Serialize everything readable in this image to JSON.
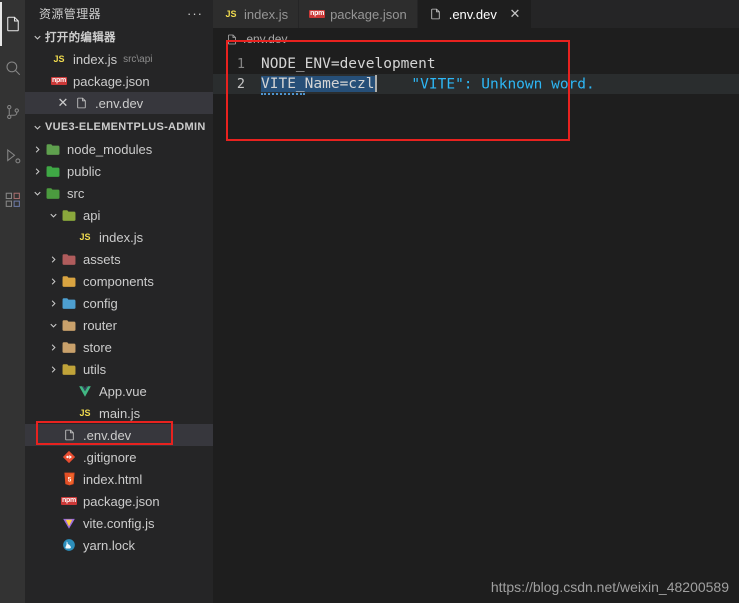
{
  "colors": {
    "activity_bar_bg": "#333333",
    "sidebar_bg": "#252526",
    "editor_bg": "#1e1e1e",
    "tab_active_bg": "#1e1e1e",
    "tab_inactive_bg": "#2d2d2d",
    "selection_bg": "#264f78",
    "annotation_red": "#e8221f",
    "hint_blue": "#2db7f5",
    "js_yellow": "#f0db4f",
    "npm_red": "#cb3837",
    "vue_green": "#41b883",
    "folder_blue": "#519aba"
  },
  "activity_bar": {
    "items": [
      {
        "name": "explorer-icon",
        "active": true
      },
      {
        "name": "search-icon",
        "active": false
      },
      {
        "name": "source-control-icon",
        "active": false
      },
      {
        "name": "run-and-debug-icon",
        "active": false
      },
      {
        "name": "extensions-icon",
        "active": false
      }
    ]
  },
  "sidebar": {
    "title": "资源管理器",
    "more_actions": "···",
    "open_editors": {
      "label": "打开的编辑器",
      "expanded": true,
      "items": [
        {
          "label": "index.js",
          "sub": "src\\api",
          "icon": "js-file-icon",
          "selected": false,
          "has_close": false
        },
        {
          "label": "package.json",
          "sub": "",
          "icon": "npm-file-icon",
          "selected": false,
          "has_close": false
        },
        {
          "label": ".env.dev",
          "sub": "",
          "icon": "plain-file-icon",
          "selected": true,
          "has_close": true
        }
      ]
    },
    "project": {
      "label": "VUE3-ELEMENTPLUS-ADMIN",
      "expanded": true,
      "tree": [
        {
          "label": "node_modules",
          "type": "folder",
          "icon": "folder-node-modules-icon",
          "depth": 1,
          "expanded": false,
          "selected": false,
          "annotated": false
        },
        {
          "label": "public",
          "type": "folder",
          "icon": "folder-public-icon",
          "depth": 1,
          "expanded": false,
          "selected": false,
          "annotated": false
        },
        {
          "label": "src",
          "type": "folder",
          "icon": "folder-src-icon",
          "depth": 1,
          "expanded": true,
          "selected": false,
          "annotated": false
        },
        {
          "label": "api",
          "type": "folder",
          "icon": "folder-api-icon",
          "depth": 2,
          "expanded": true,
          "selected": false,
          "annotated": false
        },
        {
          "label": "index.js",
          "type": "file",
          "icon": "js-file-icon",
          "depth": 3,
          "expanded": null,
          "selected": false,
          "annotated": false
        },
        {
          "label": "assets",
          "type": "folder",
          "icon": "folder-assets-icon",
          "depth": 2,
          "expanded": false,
          "selected": false,
          "annotated": false
        },
        {
          "label": "components",
          "type": "folder",
          "icon": "folder-components-icon",
          "depth": 2,
          "expanded": false,
          "selected": false,
          "annotated": false
        },
        {
          "label": "config",
          "type": "folder",
          "icon": "folder-config-icon",
          "depth": 2,
          "expanded": false,
          "selected": false,
          "annotated": false
        },
        {
          "label": "router",
          "type": "folder",
          "icon": "folder-router-icon",
          "depth": 2,
          "expanded": true,
          "selected": false,
          "annotated": false
        },
        {
          "label": "store",
          "type": "folder",
          "icon": "folder-store-icon",
          "depth": 2,
          "expanded": false,
          "selected": false,
          "annotated": false
        },
        {
          "label": "utils",
          "type": "folder",
          "icon": "folder-utils-icon",
          "depth": 2,
          "expanded": false,
          "selected": false,
          "annotated": false
        },
        {
          "label": "App.vue",
          "type": "file",
          "icon": "vue-file-icon",
          "depth": 3,
          "expanded": null,
          "selected": false,
          "annotated": false
        },
        {
          "label": "main.js",
          "type": "file",
          "icon": "js-file-icon",
          "depth": 3,
          "expanded": null,
          "selected": false,
          "annotated": false
        },
        {
          "label": ".env.dev",
          "type": "file",
          "icon": "plain-file-icon",
          "depth": 2,
          "expanded": null,
          "selected": true,
          "annotated": true
        },
        {
          "label": ".gitignore",
          "type": "file",
          "icon": "git-file-icon",
          "depth": 2,
          "expanded": null,
          "selected": false,
          "annotated": false
        },
        {
          "label": "index.html",
          "type": "file",
          "icon": "html-file-icon",
          "depth": 2,
          "expanded": null,
          "selected": false,
          "annotated": false
        },
        {
          "label": "package.json",
          "type": "file",
          "icon": "npm-file-icon",
          "depth": 2,
          "expanded": null,
          "selected": false,
          "annotated": false
        },
        {
          "label": "vite.config.js",
          "type": "file",
          "icon": "vite-file-icon",
          "depth": 2,
          "expanded": null,
          "selected": false,
          "annotated": false
        },
        {
          "label": "yarn.lock",
          "type": "file",
          "icon": "yarn-file-icon",
          "depth": 2,
          "expanded": null,
          "selected": false,
          "annotated": false
        }
      ]
    }
  },
  "editor": {
    "tabs": [
      {
        "label": "index.js",
        "icon": "js-file-icon",
        "active": false,
        "closable": false
      },
      {
        "label": "package.json",
        "icon": "npm-file-icon",
        "active": false,
        "closable": false
      },
      {
        "label": ".env.dev",
        "icon": "plain-file-icon",
        "active": true,
        "closable": true
      }
    ],
    "tab_close_glyph": "✕",
    "breadcrumb": ".env.dev",
    "lines": [
      {
        "number": "1",
        "text": "NODE_ENV=development",
        "current": false
      },
      {
        "number": "2",
        "text": "VITE_Name=czl",
        "current": true
      }
    ],
    "line2": {
      "selected_prefix": "VITE_",
      "rest": "Name=czl",
      "hint": "    \"VITE\": Unknown word."
    }
  },
  "watermark": "https://blog.csdn.net/weixin_48200589"
}
